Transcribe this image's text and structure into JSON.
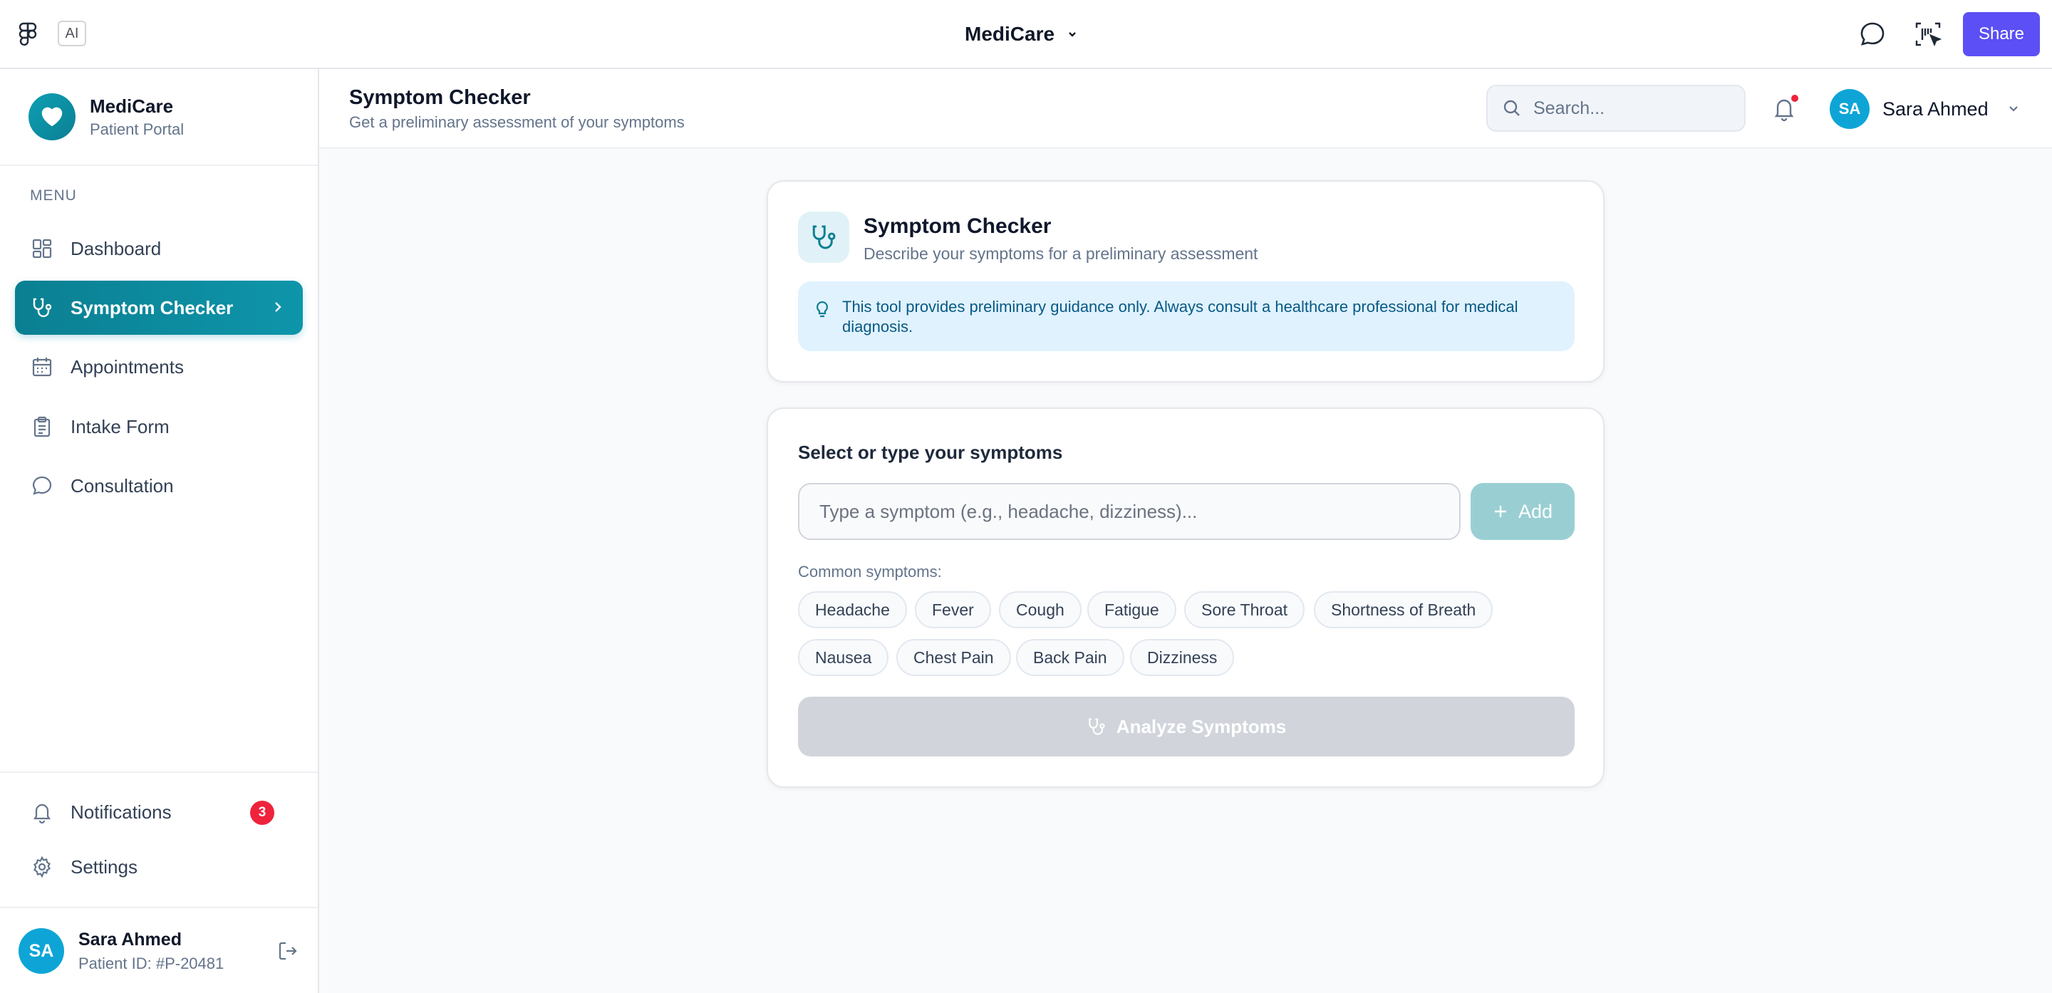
{
  "topbar": {
    "ai_label": "AI",
    "project_title": "MediCare",
    "share_label": "Share",
    "icons": [
      "figma-logo-icon",
      "chevron-down-icon",
      "chat-bubble-icon",
      "inspect-icon"
    ]
  },
  "brand": {
    "name": "MediCare",
    "subtitle": "Patient Portal"
  },
  "sidebar": {
    "menu_label": "MENU",
    "items": [
      {
        "label": "Dashboard",
        "icon": "dashboard-icon",
        "active": false
      },
      {
        "label": "Symptom Checker",
        "icon": "stethoscope-icon",
        "active": true
      },
      {
        "label": "Appointments",
        "icon": "calendar-icon",
        "active": false
      },
      {
        "label": "Intake Form",
        "icon": "clipboard-icon",
        "active": false
      },
      {
        "label": "Consultation",
        "icon": "chat-icon",
        "active": false
      }
    ],
    "notifications": {
      "label": "Notifications",
      "count": "3"
    },
    "settings": {
      "label": "Settings"
    },
    "user": {
      "initials": "SA",
      "name": "Sara Ahmed",
      "patient_id": "Patient ID: #P-20481"
    }
  },
  "header": {
    "title": "Symptom Checker",
    "subtitle": "Get a preliminary assessment of your symptoms",
    "search_placeholder": "Search...",
    "user": {
      "initials": "SA",
      "name": "Sara Ahmed"
    }
  },
  "intro_card": {
    "title": "Symptom Checker",
    "subtitle": "Describe your symptoms for a preliminary assessment",
    "notice_line1": "This tool provides preliminary guidance only. Always consult a healthcare professional for medical",
    "notice_line2": "diagnosis."
  },
  "symptom_card": {
    "label": "Select or type your symptoms",
    "input_placeholder": "Type a symptom (e.g., headache, dizziness)...",
    "input_value": "",
    "add_label": "Add",
    "common_label": "Common symptoms:",
    "common_symptoms": [
      "Headache",
      "Fever",
      "Cough",
      "Fatigue",
      "Sore Throat",
      "Shortness of Breath",
      "Nausea",
      "Chest Pain",
      "Back Pain",
      "Dizziness"
    ],
    "analyze_label": "Analyze Symptoms",
    "analyze_enabled": false
  },
  "colors": {
    "accent": "#0e95aa",
    "share": "#5b4ff5",
    "alert": "#ef233c",
    "notice_bg": "#e0f2fe"
  }
}
